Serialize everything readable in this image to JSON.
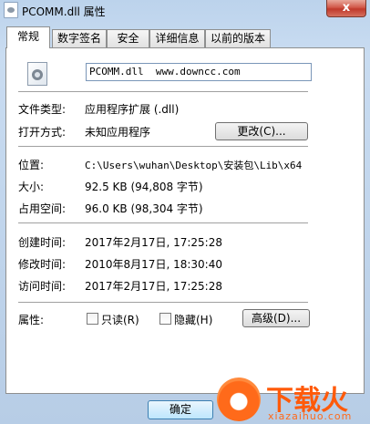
{
  "window": {
    "title": "PCOMM.dll 属性",
    "close_label": "x"
  },
  "tabs": [
    {
      "label": "常规",
      "active": true
    },
    {
      "label": "数字签名",
      "active": false
    },
    {
      "label": "安全",
      "active": false
    },
    {
      "label": "详细信息",
      "active": false
    },
    {
      "label": "以前的版本",
      "active": false
    }
  ],
  "general": {
    "file_name": "PCOMM.dll  www.downcc.com",
    "file_icon": "dll-file-icon",
    "type_label": "文件类型:",
    "type_value": "应用程序扩展 (.dll)",
    "opens_with_label": "打开方式:",
    "opens_with_value": "未知应用程序",
    "change_button": "更改(C)...",
    "location_label": "位置:",
    "location_value": "C:\\Users\\wuhan\\Desktop\\安装包\\Lib\\x64",
    "size_label": "大小:",
    "size_value": "92.5 KB (94,808 字节)",
    "size_on_disk_label": "占用空间:",
    "size_on_disk_value": "96.0 KB (98,304 字节)",
    "created_label": "创建时间:",
    "created_value": "2017年2月17日, 17:25:28",
    "modified_label": "修改时间:",
    "modified_value": "2010年8月17日, 18:30:40",
    "accessed_label": "访问时间:",
    "accessed_value": "2017年2月17日, 17:25:28",
    "attributes_label": "属性:",
    "readonly_label": "只读(R)",
    "readonly_checked": false,
    "hidden_label": "隐藏(H)",
    "hidden_checked": false,
    "advanced_button": "高级(D)..."
  },
  "footer": {
    "ok_button": "确定"
  },
  "watermark": {
    "text": "下载火",
    "url": "xiazaihuo.com"
  }
}
